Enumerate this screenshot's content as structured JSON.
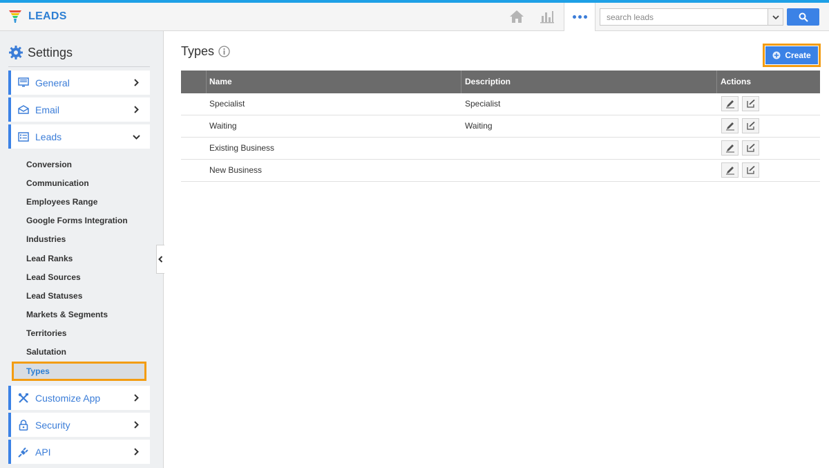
{
  "app": {
    "name": "LEADS"
  },
  "header": {
    "search_placeholder": "search leads"
  },
  "sidebar": {
    "title": "Settings",
    "nav": [
      {
        "label": "General"
      },
      {
        "label": "Email"
      },
      {
        "label": "Leads"
      },
      {
        "label": "Customize App"
      },
      {
        "label": "Security"
      },
      {
        "label": "API"
      }
    ],
    "sub_items": [
      {
        "label": "Conversion"
      },
      {
        "label": "Communication"
      },
      {
        "label": "Employees Range"
      },
      {
        "label": "Google Forms Integration"
      },
      {
        "label": "Industries"
      },
      {
        "label": "Lead Ranks"
      },
      {
        "label": "Lead Sources"
      },
      {
        "label": "Lead Statuses"
      },
      {
        "label": "Markets & Segments"
      },
      {
        "label": "Territories"
      },
      {
        "label": "Salutation"
      },
      {
        "label": "Types"
      }
    ],
    "active_sub": "Types"
  },
  "main": {
    "title": "Types",
    "create_label": "Create",
    "columns": {
      "name": "Name",
      "description": "Description",
      "actions": "Actions"
    },
    "rows": [
      {
        "name": "Specialist",
        "description": "Specialist"
      },
      {
        "name": "Waiting",
        "description": "Waiting"
      },
      {
        "name": "Existing Business",
        "description": ""
      },
      {
        "name": "New Business",
        "description": ""
      }
    ]
  },
  "colors": {
    "accent": "#3b82e6",
    "highlight": "#f39c12",
    "header_bar": "#6b6b6b",
    "top_line": "#1ea0e6"
  },
  "icons": {
    "brand": "funnel-icon",
    "home": "home-icon",
    "stats": "bar-chart-icon",
    "more": "more-dots-icon",
    "search": "search-icon",
    "settings": "gear-icon",
    "general": "monitor-icon",
    "email": "envelope-icon",
    "leads": "list-icon",
    "customize": "tools-icon",
    "security": "lock-icon",
    "api": "plug-icon",
    "edit": "pencil-icon",
    "assign": "checkbox-edit-icon",
    "info": "info-icon",
    "create": "plus-circle-icon"
  }
}
